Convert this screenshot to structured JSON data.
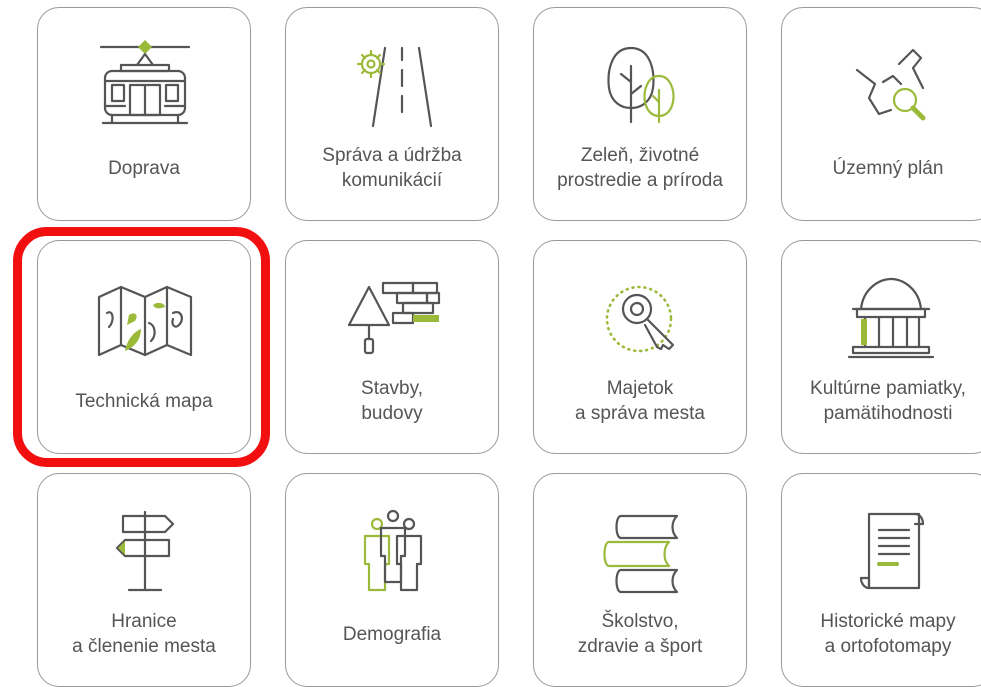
{
  "tiles": [
    {
      "id": "doprava",
      "label": [
        "Doprava"
      ],
      "icon": "tram-icon"
    },
    {
      "id": "sprava-udrzba",
      "label": [
        "Správa a údržba",
        "komunikácií"
      ],
      "icon": "road-gear-icon"
    },
    {
      "id": "zelen",
      "label": [
        "Zeleň, životné",
        "prostredie a príroda"
      ],
      "icon": "trees-icon"
    },
    {
      "id": "uzemny-plan",
      "label": [
        "Územný plán"
      ],
      "icon": "map-magnifier-icon"
    },
    {
      "id": "technicka-mapa",
      "label": [
        "Technická mapa"
      ],
      "icon": "folded-map-icon"
    },
    {
      "id": "stavby",
      "label": [
        "Stavby,",
        "budovy"
      ],
      "icon": "bricks-trowel-icon"
    },
    {
      "id": "majetok",
      "label": [
        "Majetok",
        "a správa mesta"
      ],
      "icon": "key-icon"
    },
    {
      "id": "kulturne-pamiatky",
      "label": [
        "Kultúrne pamiatky,",
        "pamätihodnosti"
      ],
      "icon": "temple-icon"
    },
    {
      "id": "hranice",
      "label": [
        "Hranice",
        "a členenie mesta"
      ],
      "icon": "signpost-icon"
    },
    {
      "id": "demografia",
      "label": [
        "Demografia"
      ],
      "icon": "people-icon"
    },
    {
      "id": "skolstvo",
      "label": [
        "Školstvo,",
        "zdravie a šport"
      ],
      "icon": "books-icon"
    },
    {
      "id": "historicke-mapy",
      "label": [
        "Historické mapy",
        "a ortofotomapy"
      ],
      "icon": "scroll-icon"
    }
  ],
  "highlighted_tile": "technicka-mapa",
  "colors": {
    "accent_green": "#9cba3a",
    "icon_gray": "#555555",
    "border": "#9a9a9a",
    "highlight_red": "#f20f0f"
  }
}
